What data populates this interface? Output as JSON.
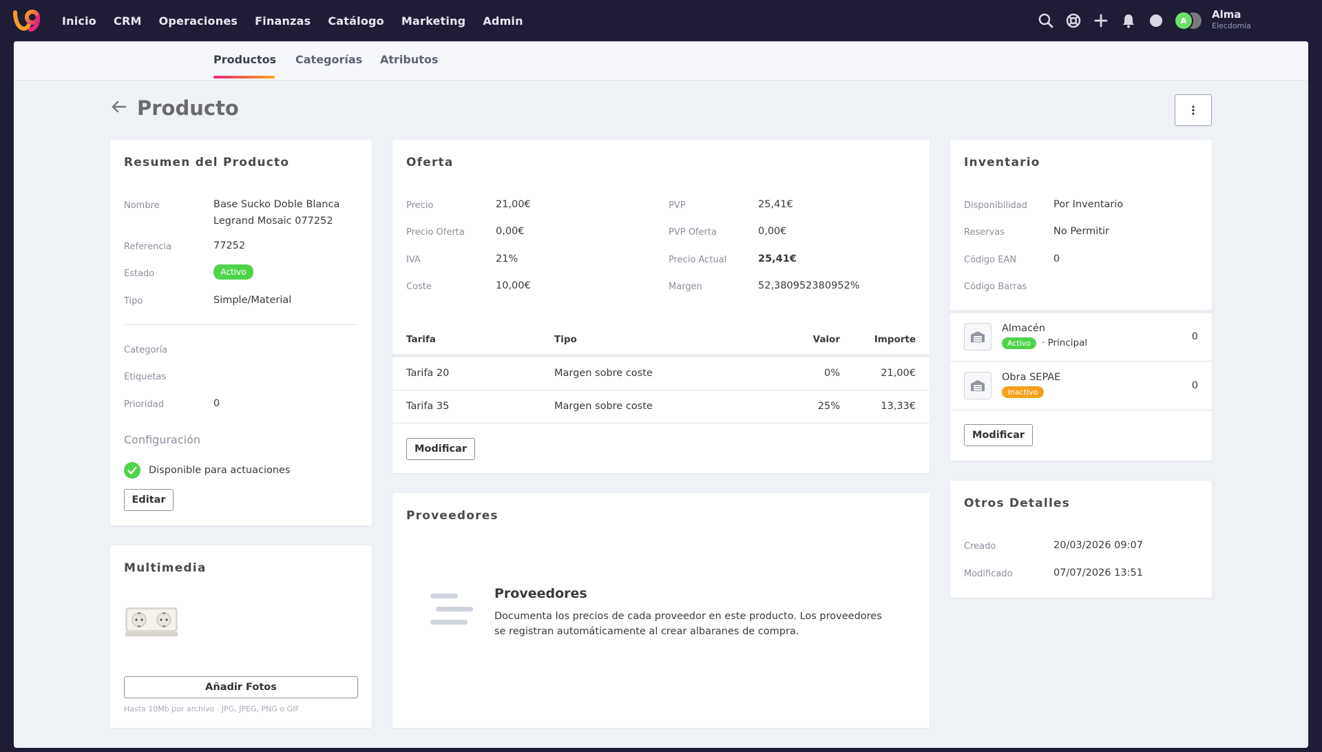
{
  "nav": {
    "links": [
      "Inicio",
      "CRM",
      "Operaciones",
      "Finanzas",
      "Catálogo",
      "Marketing",
      "Admin"
    ],
    "user": {
      "name": "Alma",
      "org": "Elecdomia",
      "initial": "A"
    }
  },
  "subnav": {
    "tabs": [
      "Productos",
      "Categorías",
      "Atributos"
    ],
    "active": "Productos"
  },
  "page": {
    "title": "Producto"
  },
  "summary": {
    "title": "Resumen del Producto",
    "nombre_label": "Nombre",
    "nombre_line1": "Base Sucko Doble Blanca",
    "nombre_line2": "Legrand Mosaic 077252",
    "referencia_label": "Referencia",
    "referencia": "77252",
    "estado_label": "Estado",
    "estado": "Activo",
    "tipo_label": "Tipo",
    "tipo": "Simple/Material",
    "categoria_label": "Categoría",
    "etiquetas_label": "Etiquetas",
    "prioridad_label": "Prioridad",
    "prioridad": "0",
    "config_title": "Configuración",
    "config_item": "Disponible para actuaciones",
    "edit_button": "Editar"
  },
  "media": {
    "title": "Multimedia",
    "add_button": "Añadir Fotos",
    "hint": "Hasta 10Mb por archivo · JPG, JPEG, PNG o GIF"
  },
  "offer": {
    "title": "Oferta",
    "precio_label": "Precio",
    "precio": "21,00€",
    "precio_oferta_label": "Precio Oferta",
    "precio_oferta": "0,00€",
    "iva_label": "IVA",
    "iva": "21%",
    "coste_label": "Coste",
    "coste": "10,00€",
    "pvp_label": "PVP",
    "pvp": "25,41€",
    "pvp_oferta_label": "PVP Oferta",
    "pvp_oferta": "0,00€",
    "precio_actual_label": "Precio Actual",
    "precio_actual": "25,41€",
    "margen_label": "Margen",
    "margen": "52,380952380952%",
    "columns": [
      "Tarifa",
      "Tipo",
      "Valor",
      "Importe"
    ],
    "rows": [
      {
        "tarifa": "Tarifa 20",
        "tipo": "Margen sobre coste",
        "valor": "0%",
        "importe": "21,00€"
      },
      {
        "tarifa": "Tarifa 35",
        "tipo": "Margen sobre coste",
        "valor": "25%",
        "importe": "13,33€"
      }
    ],
    "modify_button": "Modificar"
  },
  "suppliers": {
    "title": "Proveedores",
    "empty_title": "Proveedores",
    "empty_desc": "Documenta los precios de cada proveedor en este producto. Los proveedores se registran automáticamente al crear albaranes de compra."
  },
  "inventory": {
    "title": "Inventario",
    "disponibilidad_label": "Disponibilidad",
    "disponibilidad": "Por Inventario",
    "reservas_label": "Reservas",
    "reservas": "No Permitir",
    "ean_label": "Código EAN",
    "ean": "0",
    "barras_label": "Código Barras",
    "warehouses": [
      {
        "name": "Almacén",
        "status": "Activo",
        "extra": "· Principal",
        "qty": "0"
      },
      {
        "name": "Obra SEPAE",
        "status": "Inactivo",
        "extra": "",
        "qty": "0"
      }
    ],
    "modify_button": "Modificar"
  },
  "details": {
    "title": "Otros Detalles",
    "creado_label": "Creado",
    "creado": "20/03/2026 09:07",
    "modificado_label": "Modificado",
    "modificado": "07/07/2026 13:51"
  },
  "colors": {
    "nav_bg": "#1f1d36",
    "page_bg": "#eef1f6",
    "active_green": "#4fd34a",
    "inactive_orange": "#f5a01a"
  }
}
